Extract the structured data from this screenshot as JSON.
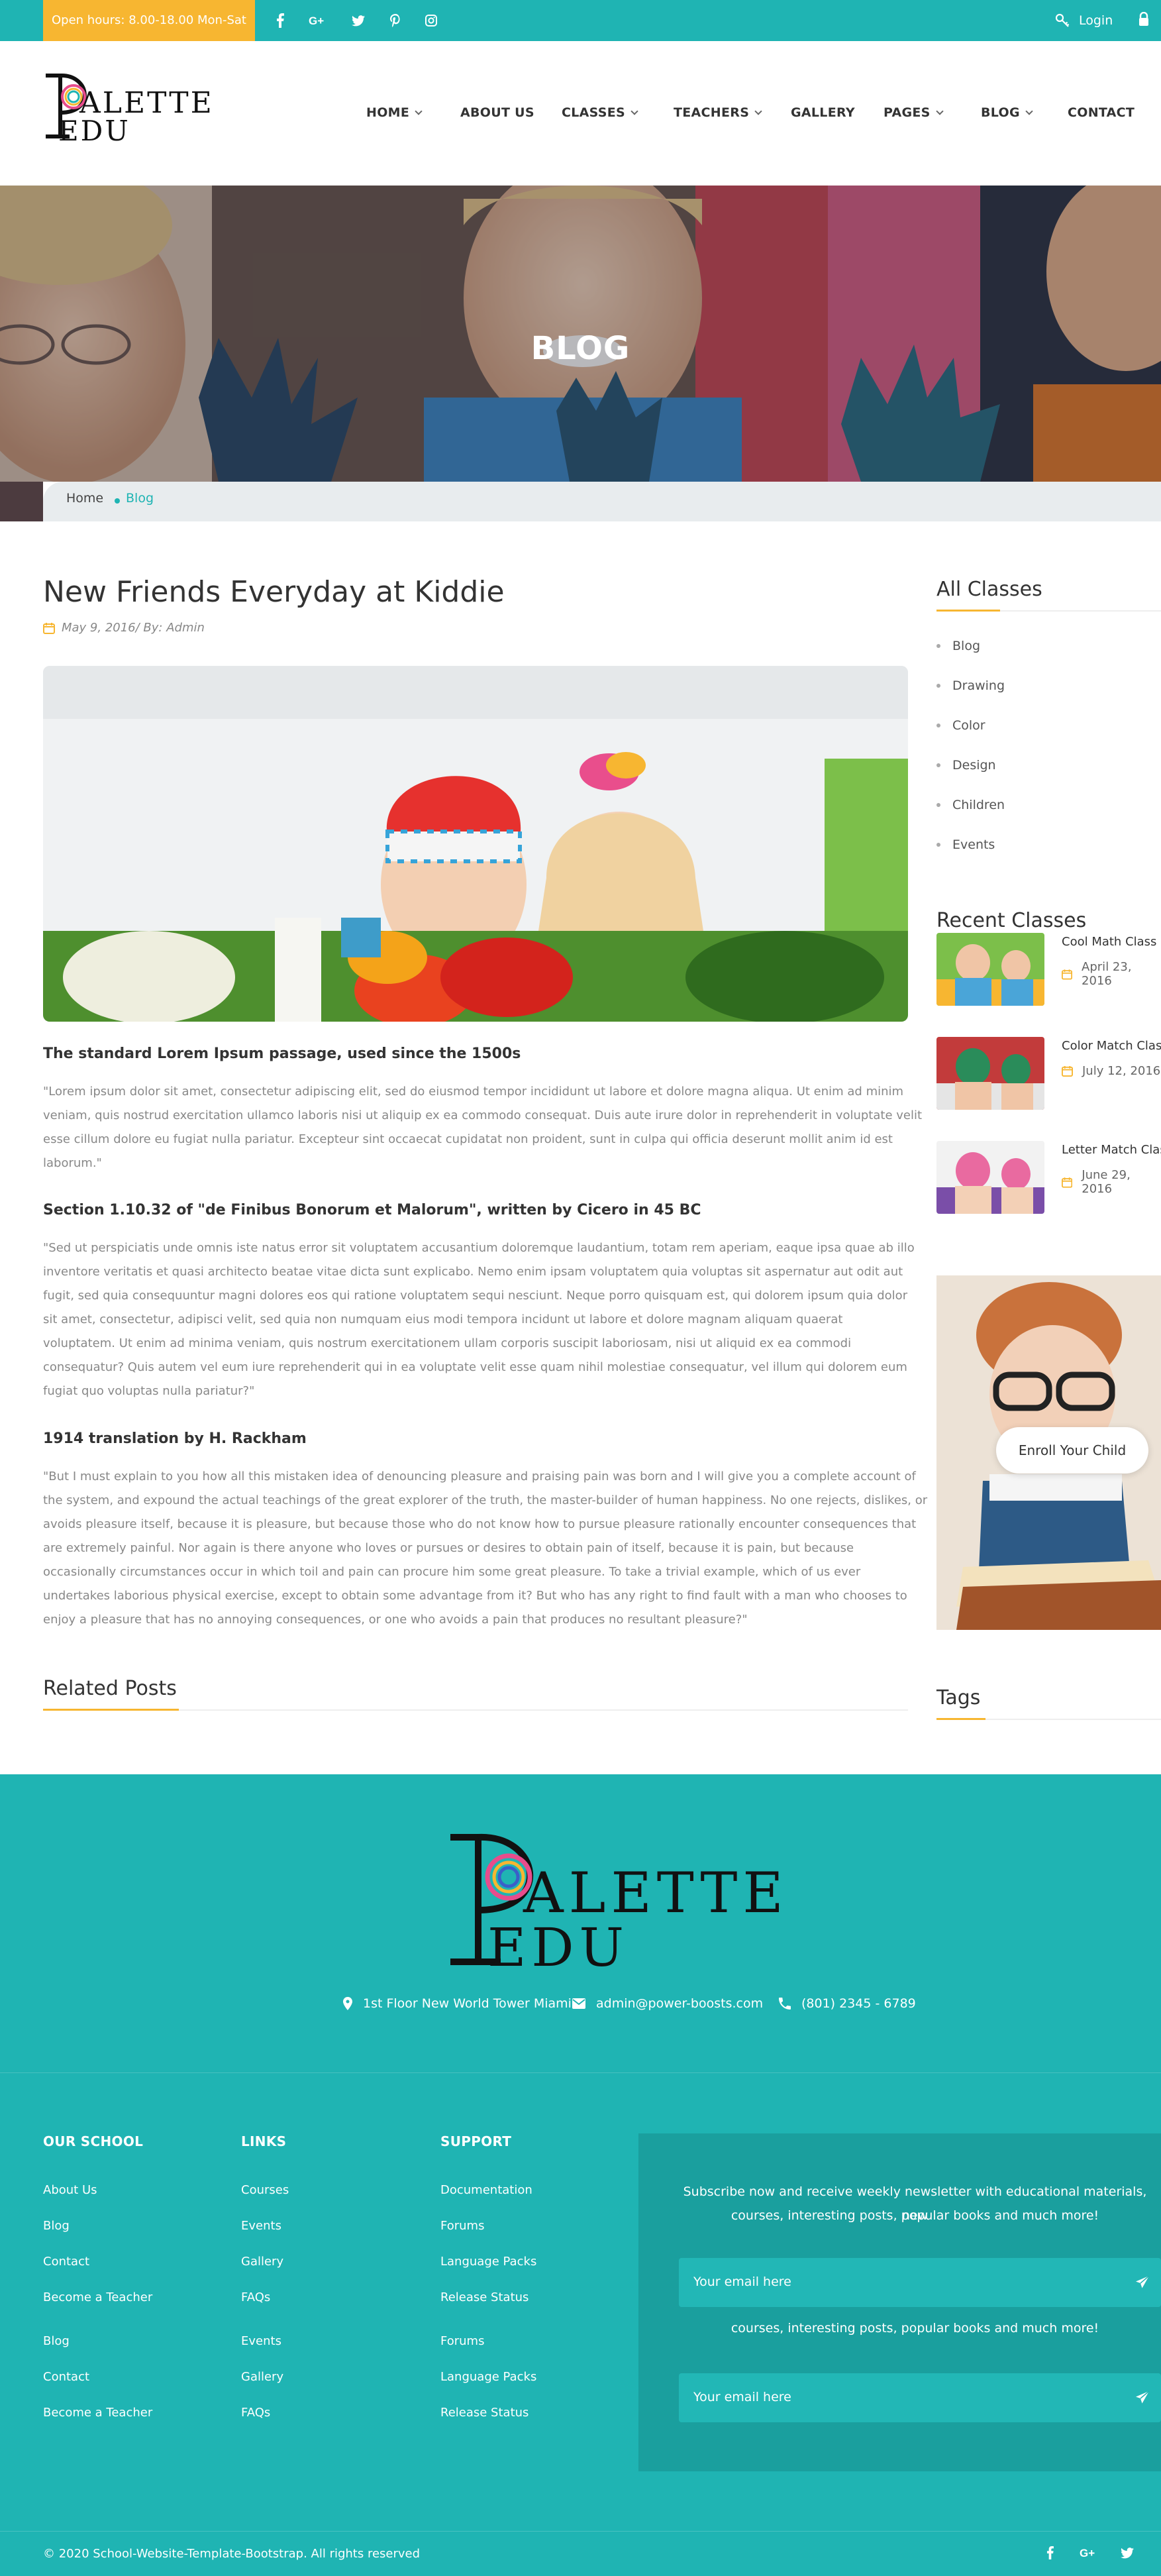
{
  "topbar": {
    "hours": "Open hours: 8.00-18.00 Mon-Sat",
    "social_icons": [
      "facebook-icon",
      "google-plus-icon",
      "twitter-icon",
      "pinterest-icon",
      "instagram-icon"
    ],
    "login": "Login"
  },
  "logo": {
    "line1": "ALETTE",
    "line2": "EDU",
    "letter": "P"
  },
  "nav": {
    "items": [
      {
        "label": "HOME",
        "dropdown": true
      },
      {
        "label": "ABOUT US",
        "dropdown": false
      },
      {
        "label": "CLASSES",
        "dropdown": true
      },
      {
        "label": "TEACHERS",
        "dropdown": true
      },
      {
        "label": "GALLERY",
        "dropdown": false
      },
      {
        "label": "PAGES",
        "dropdown": true
      },
      {
        "label": "BLOG",
        "dropdown": true
      },
      {
        "label": "CONTACT",
        "dropdown": false
      }
    ]
  },
  "hero": {
    "title": "BLOG"
  },
  "breadcrumb": {
    "home": "Home",
    "current": "Blog"
  },
  "post": {
    "title": "New Friends Everyday at Kiddie",
    "meta": "May 9, 2016/ By: Admin",
    "sections": [
      {
        "heading": "The standard Lorem Ipsum passage, used since the 1500s",
        "lines": [
          "\"Lorem ipsum dolor sit amet, consectetur adipiscing elit, sed do eiusmod tempor incididunt ut labore et dolore magna aliqua. Ut enim ad minim",
          "veniam, quis nostrud exercitation ullamco laboris nisi ut aliquip ex ea commodo consequat. Duis aute irure dolor in reprehenderit in voluptate velit",
          "esse cillum dolore eu fugiat nulla pariatur. Excepteur sint occaecat cupidatat non proident, sunt in culpa qui officia deserunt mollit anim id est",
          "laborum.\""
        ]
      },
      {
        "heading": "Section 1.10.32 of \"de Finibus Bonorum et Malorum\", written by Cicero in 45 BC",
        "lines": [
          "\"Sed ut perspiciatis unde omnis iste natus error sit voluptatem accusantium doloremque laudantium, totam rem aperiam, eaque ipsa quae ab illo",
          "inventore veritatis et quasi architecto beatae vitae dicta sunt explicabo. Nemo enim ipsam voluptatem quia voluptas sit aspernatur aut odit aut",
          "fugit, sed quia consequuntur magni dolores eos qui ratione voluptatem sequi nesciunt. Neque porro quisquam est, qui dolorem ipsum quia dolor",
          "sit amet, consectetur, adipisci velit, sed quia non numquam eius modi tempora incidunt ut labore et dolore magnam aliquam quaerat",
          "voluptatem. Ut enim ad minima veniam, quis nostrum exercitationem ullam corporis suscipit laboriosam, nisi ut aliquid ex ea commodi",
          "consequatur? Quis autem vel eum iure reprehenderit qui in ea voluptate velit esse quam nihil molestiae consequatur, vel illum qui dolorem eum",
          "fugiat quo voluptas nulla pariatur?\""
        ]
      },
      {
        "heading": "1914 translation by H. Rackham",
        "lines": [
          "\"But I must explain to you how all this mistaken idea of denouncing pleasure and praising pain was born and I will give you a complete account of",
          "the system, and expound the actual teachings of the great explorer of the truth, the master-builder of human happiness. No one rejects, dislikes, or",
          "avoids pleasure itself, because it is pleasure, but because those who do not know how to pursue pleasure rationally encounter consequences that",
          "are extremely painful. Nor again is there anyone who loves or pursues or desires to obtain pain of itself, because it is pain, but because",
          "occasionally circumstances occur in which toil and pain can procure him some great pleasure. To take a trivial example, which of us ever",
          "undertakes laborious physical exercise, except to obtain some advantage from it? But who has any right to find fault with a man who chooses to",
          "enjoy a pleasure that has no annoying consequences, or one who avoids a pain that produces no resultant pleasure?\""
        ]
      }
    ],
    "related_title": "Related Posts"
  },
  "sidebar": {
    "all_classes_title": "All Classes",
    "categories": [
      "Blog",
      "Drawing",
      "Color",
      "Design",
      "Children",
      "Events"
    ],
    "recent_title": "Recent Classes",
    "recent": [
      {
        "title": "Cool Math Class",
        "date": "April 23, 2016"
      },
      {
        "title": "Color Match Class",
        "date": "July 12, 2016"
      },
      {
        "title": "Letter Match Class",
        "date": "June 29, 2016"
      }
    ],
    "enroll": "Enroll Your Child",
    "tags_title": "Tags"
  },
  "footer": {
    "address": "1st Floor New World Tower Miami",
    "email": "admin@power-boosts.com",
    "phone": "(801) 2345 - 6789",
    "columns": [
      {
        "heading": "OUR SCHOOL",
        "links": [
          "About Us",
          "Blog",
          "Contact",
          "Become a Teacher",
          "Blog",
          "Contact",
          "Become a Teacher"
        ]
      },
      {
        "heading": "LINKS",
        "links": [
          "Courses",
          "Events",
          "Gallery",
          "FAQs",
          "Events",
          "Gallery",
          "FAQs"
        ]
      },
      {
        "heading": "SUPPORT",
        "links": [
          "Documentation",
          "Forums",
          "Language Packs",
          "Release Status",
          "Forums",
          "Language Packs",
          "Release Status"
        ]
      }
    ],
    "newsletter_line1": "Subscribe now and receive weekly newsletter with educational materials, new",
    "newsletter_line2": "courses, interesting posts, popular books and much more!",
    "newsletter_line3": "courses, interesting posts, popular books and much more!",
    "email_placeholder": "Your email here",
    "copyright": "© 2020 School-Website-Template-Bootstrap. All rights reserved",
    "bottom_social": [
      "facebook-icon",
      "google-plus-icon",
      "twitter-icon"
    ]
  },
  "colors": {
    "teal": "#1fb4b3",
    "yellow": "#f7b631",
    "dark_teal": "#1a9f9e"
  }
}
